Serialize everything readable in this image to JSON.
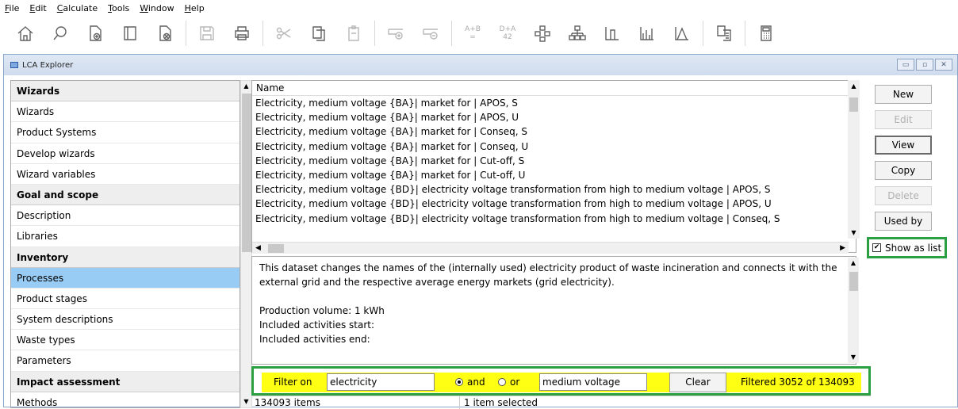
{
  "menu": {
    "file": "File",
    "edit": "Edit",
    "calculate": "Calculate",
    "tools": "Tools",
    "window": "Window",
    "help": "Help"
  },
  "toolbar": {
    "buttons": [
      "home-icon",
      "search-icon",
      "new-document-icon",
      "open-book-icon",
      "close-document-icon",
      "save-icon",
      "print-icon",
      "cut-icon",
      "copy-icon",
      "paste-icon",
      "add-icon",
      "remove-icon",
      "calc-ab-icon",
      "calc-da-icon",
      "network-icon",
      "tree-icon",
      "single-score-icon",
      "characterization-icon",
      "curve-icon",
      "compare-icon",
      "calculator-icon"
    ],
    "ab_top": "A+B",
    "ab_bottom": "=",
    "da_top": "D+A",
    "da_bottom": "42"
  },
  "window": {
    "title": "LCA Explorer"
  },
  "nav": [
    {
      "label": "Wizards",
      "type": "header"
    },
    {
      "label": "Wizards",
      "type": "item"
    },
    {
      "label": "Product Systems",
      "type": "item"
    },
    {
      "label": "Develop wizards",
      "type": "item"
    },
    {
      "label": "Wizard variables",
      "type": "item"
    },
    {
      "label": "Goal and scope",
      "type": "header"
    },
    {
      "label": "Description",
      "type": "item"
    },
    {
      "label": "Libraries",
      "type": "item"
    },
    {
      "label": "Inventory",
      "type": "header"
    },
    {
      "label": "Processes",
      "type": "selected"
    },
    {
      "label": "Product stages",
      "type": "item"
    },
    {
      "label": "System descriptions",
      "type": "item"
    },
    {
      "label": "Waste types",
      "type": "item"
    },
    {
      "label": "Parameters",
      "type": "item"
    },
    {
      "label": "Impact assessment",
      "type": "header"
    },
    {
      "label": "Methods",
      "type": "item"
    }
  ],
  "list": {
    "column": "Name",
    "rows": [
      "Electricity, medium voltage {BA}| market for | APOS, S",
      "Electricity, medium voltage {BA}| market for | APOS, U",
      "Electricity, medium voltage {BA}| market for | Conseq, S",
      "Electricity, medium voltage {BA}| market for | Conseq, U",
      "Electricity, medium voltage {BA}| market for | Cut-off, S",
      "Electricity, medium voltage {BA}| market for | Cut-off, U",
      "Electricity, medium voltage {BD}| electricity voltage transformation from high to medium voltage | APOS, S",
      "Electricity, medium voltage {BD}| electricity voltage transformation from high to medium voltage | APOS, U",
      "Electricity, medium voltage {BD}| electricity voltage transformation from high to medium voltage | Conseq, S"
    ]
  },
  "description": {
    "lines": [
      "This dataset changes the names of the (internally used) electricity product of waste incineration and connects it with the external grid and the respective average energy markets (grid electricity).",
      "",
      "Production volume: 1 kWh",
      "Included activities start:",
      "Included activities end:"
    ]
  },
  "buttons": {
    "new": "New",
    "edit": "Edit",
    "view": "View",
    "copy": "Copy",
    "delete": "Delete",
    "used_by": "Used by"
  },
  "show_as_list": {
    "label": "Show as list",
    "checked": true
  },
  "filter": {
    "label": "Filter on",
    "value1": "electricity",
    "and_label": "and",
    "or_label": "or",
    "selected": "and",
    "value2": "medium voltage",
    "clear_label": "Clear",
    "result": "Filtered 3052 of 134093"
  },
  "status": {
    "items": "134093 items",
    "selected": "1 item selected"
  },
  "colors": {
    "highlight": "#2aa042",
    "filter_bg": "#ffff14",
    "selection": "#99ccf4"
  }
}
